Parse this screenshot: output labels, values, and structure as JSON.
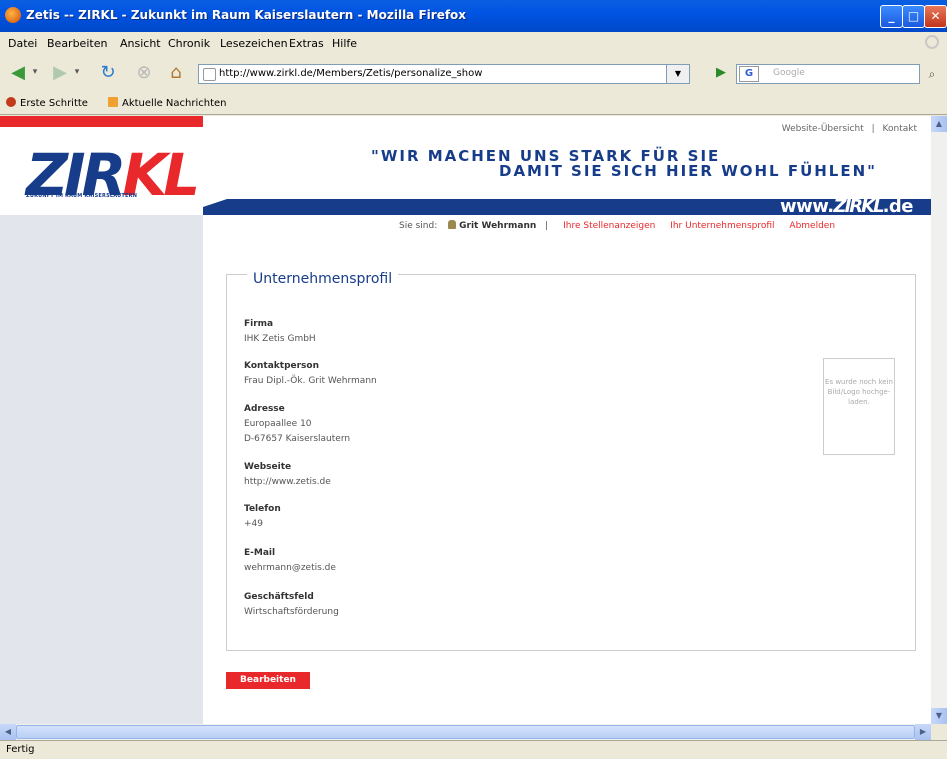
{
  "window": {
    "title": "Zetis -- ZIRKL - Zukunkt im Raum Kaiserslautern - Mozilla Firefox"
  },
  "menu": [
    "Datei",
    "Bearbeiten",
    "Ansicht",
    "Chronik",
    "Lesezeichen",
    "Extras",
    "Hilfe"
  ],
  "toolbar": {
    "url": "http://www.zirkl.de/Members/Zetis/personalize_show",
    "search_placeholder": "Google",
    "search_engine": "G"
  },
  "bookmarks": [
    "Erste Schritte",
    "Aktuelle Nachrichten"
  ],
  "site": {
    "logo_zi": "ZI",
    "logo_r": "R",
    "logo_kl": "KL",
    "logo_sub": "ZUKUNFT IM RAUM KAISERSLAUTERN",
    "toplink_sitemap": "Website-Übersicht",
    "toplink_sep": "|",
    "toplink_contact": "Kontakt",
    "slogan_line1": "\"WIR MACHEN UNS STARK FÜR SIE",
    "slogan_line2": "DAMIT SIE SICH HIER WOHL FÜHLEN\"",
    "www_prefix": "www.",
    "www_brand": "ZIRKL",
    "www_suffix": ".de",
    "brand_red": "#e8282b",
    "brand_blue": "#173c8a"
  },
  "userbar": {
    "prefix": "Sie sind:",
    "user": "Grit Wehrmann",
    "sep": "|",
    "link_ads": "Ihre Stellenanzeigen",
    "link_profile": "Ihr Unternehmensprofil",
    "link_logout": "Abmelden"
  },
  "profile": {
    "heading": "Unternehmensprofil",
    "fields": [
      {
        "label": "Firma",
        "value": "IHK Zetis GmbH"
      },
      {
        "label": "Kontaktperson",
        "value": "Frau Dipl.-Ök. Grit Wehrmann"
      },
      {
        "label": "Adresse",
        "value": "Europaallee 10",
        "value2": "D-67657 Kaiserslautern"
      },
      {
        "label": "Webseite",
        "value": "http://www.zetis.de"
      },
      {
        "label": "Telefon",
        "value": "+49"
      },
      {
        "label": "E-Mail",
        "value": "wehrmann@zetis.de"
      },
      {
        "label": "Geschäftsfeld",
        "value": "Wirtschaftsförderung"
      }
    ],
    "image_placeholder": "Es wurde noch kein Bild/Logo hochge-laden.",
    "edit_button": "Bearbeiten"
  },
  "status": "Fertig"
}
